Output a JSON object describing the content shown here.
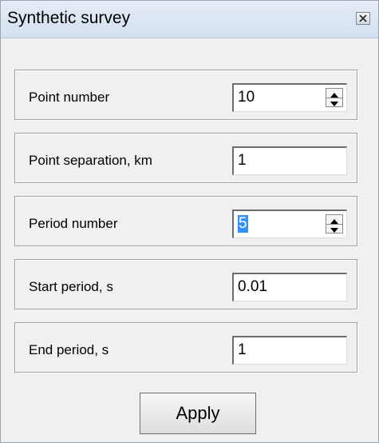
{
  "window": {
    "title": "Synthetic survey"
  },
  "fields": {
    "point_number": {
      "label": "Point number",
      "value": "10"
    },
    "point_separation": {
      "label": "Point separation, km",
      "value": "1"
    },
    "period_number": {
      "label": "Period number",
      "value": "5"
    },
    "start_period": {
      "label": "Start period, s",
      "value": "0.01"
    },
    "end_period": {
      "label": "End period, s",
      "value": "1"
    }
  },
  "buttons": {
    "apply_label": "Apply"
  },
  "icons": {
    "close": "close-icon",
    "spin_up": "arrow-up-icon",
    "spin_down": "arrow-down-icon"
  },
  "colors": {
    "selection": "#3390ff",
    "titlebar": "#dbe6f3"
  }
}
